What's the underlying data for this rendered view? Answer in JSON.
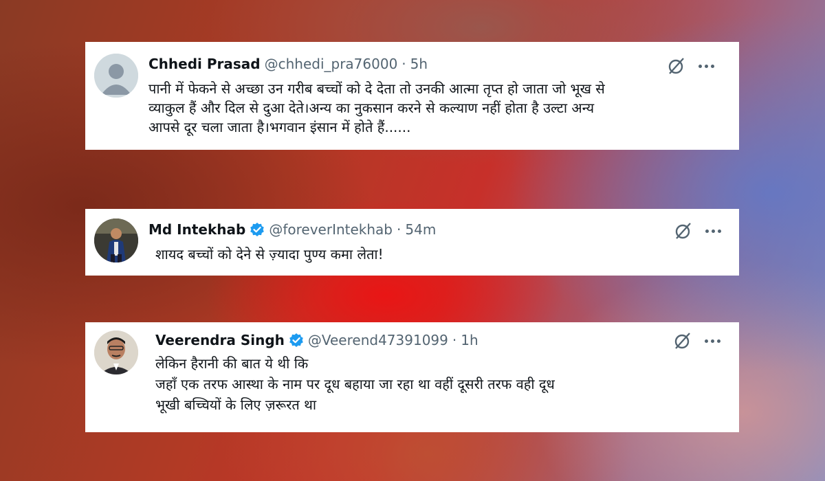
{
  "tweets": [
    {
      "name": "Chhedi Prasad",
      "handle": "@chhedi_pra76000",
      "separator": "·",
      "time": "5h",
      "verified": false,
      "lines": [
        "पानी में फेकने से अच्छा उन गरीब बच्चों को दे देता तो उनकी आत्मा तृप्त हो जाता जो भूख से",
        "व्याकुल हैं और दिल से दुआ देते।अन्य का नुकसान करने से कल्याण नहीं होता है उल्टा अन्य",
        "आपसे दूर चला जाता है।भगवान इंसान में होते हैं......"
      ]
    },
    {
      "name": "Md Intekhab",
      "handle": "@foreverIntekhab",
      "separator": "·",
      "time": "54m",
      "verified": true,
      "lines": [
        "शायद बच्चों को देने से ज़्यादा पुण्य कमा लेता!"
      ]
    },
    {
      "name": "Veerendra Singh",
      "handle": "@Veerend47391099",
      "separator": "·",
      "time": "1h",
      "verified": true,
      "lines": [
        "लेकिन हैरानी की बात ये थी कि",
        "जहाँ एक तरफ आस्था के नाम पर दूध बहाया जा रहा था वहीं दूसरी तरफ वही दूध",
        "भूखी बच्चियों के लिए ज़रूरत था"
      ]
    }
  ],
  "icons": {
    "grok": "grok-icon",
    "more": "more-options-icon",
    "verified": "verified-badge-icon"
  },
  "colors": {
    "verified_blue": "#1d9bf0",
    "secondary_text": "#536471",
    "primary_text": "#0f1419"
  }
}
